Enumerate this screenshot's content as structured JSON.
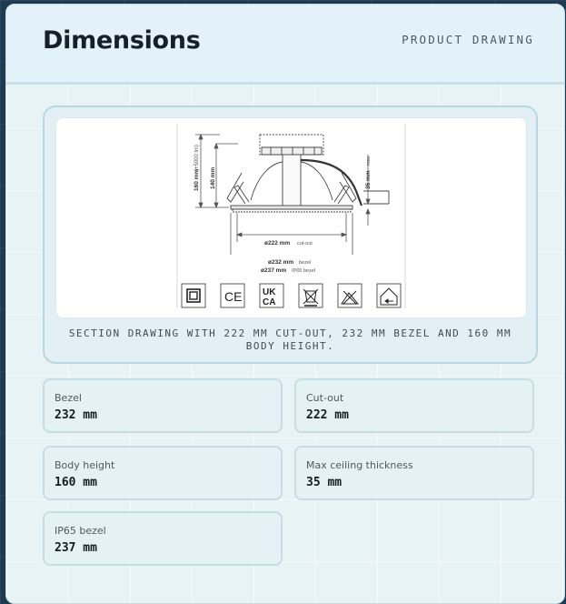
{
  "header": {
    "title": "Dimensions",
    "eyebrow": "PRODUCT DRAWING"
  },
  "figure": {
    "caption": "SECTION DRAWING WITH 222 MM CUT-OUT, 232 MM BEZEL AND 160 MM BODY HEIGHT.",
    "labels": {
      "height_total": "160 mm",
      "height_total_note": "(+5000 lm)",
      "height_body": "140 mm",
      "ceiling": "35 mm",
      "ceiling_note": "max",
      "cutout": "ø222 mm",
      "cutout_note": "cut-out",
      "bezel": "ø232 mm",
      "bezel_note": "bezel",
      "ip65": "ø237 mm",
      "ip65_note": "IP65 bezel"
    },
    "cert_icons": [
      "class-ii-icon",
      "ce-mark-icon",
      "ukca-mark-icon",
      "weee-bin-icon",
      "no-insulation-cover-icon",
      "indoor-use-icon"
    ]
  },
  "specs": [
    {
      "label": "Bezel",
      "value": "232 mm"
    },
    {
      "label": "Cut-out",
      "value": "222 mm"
    },
    {
      "label": "Body height",
      "value": "160 mm"
    },
    {
      "label": "Max ceiling thickness",
      "value": "35 mm"
    },
    {
      "label": "IP65 bezel",
      "value": "237 mm"
    }
  ]
}
